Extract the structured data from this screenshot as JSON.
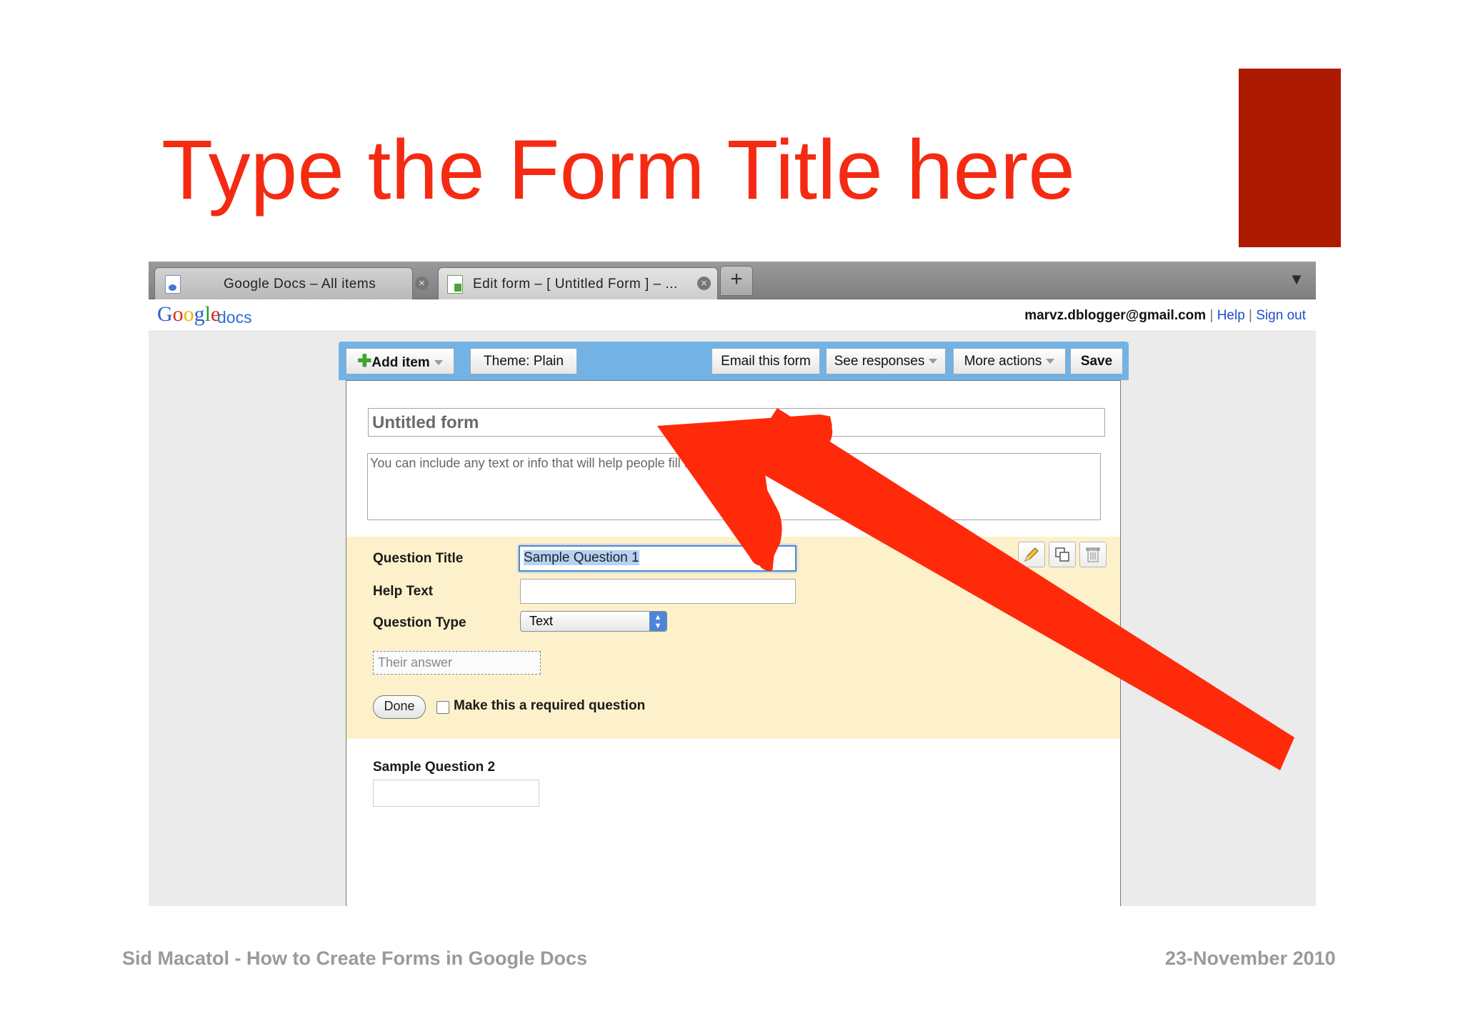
{
  "slide": {
    "title": "Type the Form Title here",
    "footer_left": "Sid Macatol - How to Create Forms in Google Docs",
    "footer_right": "23-November 2010",
    "accent_color": "#ac1a02",
    "title_color": "#f52a12",
    "arrow_color": "#ff2a0a"
  },
  "browser": {
    "tabs": [
      {
        "label": "Google Docs – All items",
        "icon": "docs-icon"
      },
      {
        "label": "Edit form – [ Untitled Form ] – ...",
        "icon": "spreadsheet-icon"
      }
    ],
    "new_tab_label": "+"
  },
  "header": {
    "logo": "Google",
    "product": "docs",
    "email": "marvz.dblogger@gmail.com",
    "separator": "|",
    "help": "Help",
    "sign_out": "Sign out"
  },
  "toolbar": {
    "add_item": "Add item",
    "theme": "Theme:  Plain",
    "email_form": "Email this form",
    "see_responses": "See responses",
    "more_actions": "More actions",
    "save": "Save"
  },
  "form": {
    "title": "Untitled form",
    "description": "You can include any text or info that will help people fill this out.",
    "question1": {
      "title_label": "Question Title",
      "title_value": "Sample Question 1",
      "help_label": "Help Text",
      "help_value": "",
      "type_label": "Question Type",
      "type_value": "Text",
      "answer_placeholder": "Their answer",
      "done": "Done",
      "required_label": "Make this a required question",
      "required_checked": false
    },
    "question2": {
      "title": "Sample Question 2"
    }
  }
}
